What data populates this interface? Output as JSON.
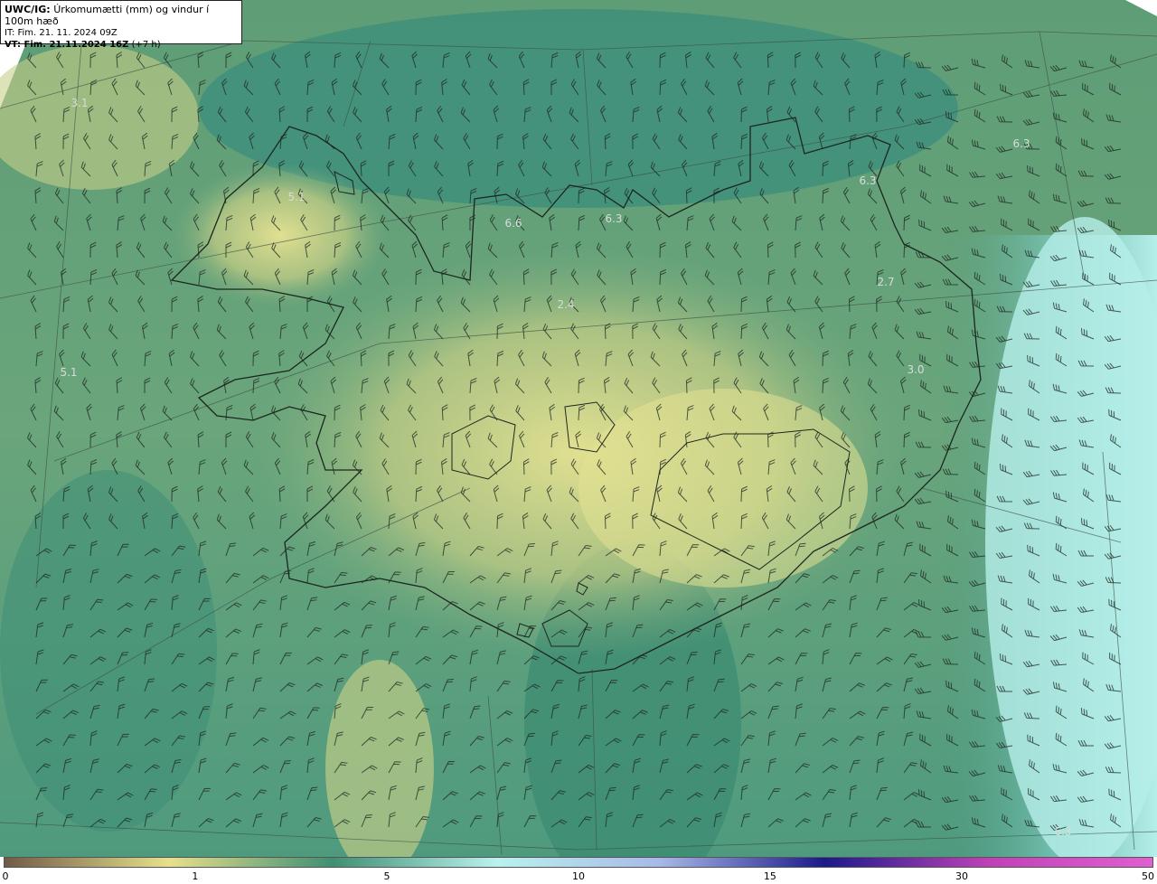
{
  "header": {
    "product": "UWC/IG:",
    "title": "Úrkomumætti (mm) og vindur í 100m hæð",
    "init_time": "IT: Fim. 21. 11. 2024 09Z",
    "valid_time_label": "VT: Fim. 21.11.2024 16Z",
    "lead": "(+7 h)"
  },
  "legend": {
    "ticks": [
      {
        "label": "0",
        "pos": 0.0
      },
      {
        "label": "1",
        "pos": 0.1666
      },
      {
        "label": "5",
        "pos": 0.3333
      },
      {
        "label": "10",
        "pos": 0.5
      },
      {
        "label": "15",
        "pos": 0.6666
      },
      {
        "label": "30",
        "pos": 0.8333
      },
      {
        "label": "50",
        "pos": 1.0
      }
    ],
    "colors": [
      "#6f5b45",
      "#e8e08a",
      "#3f8f72",
      "#b9f2ee",
      "#a8b8e8",
      "#1a1a8a",
      "#c040b8",
      "#e060d0"
    ]
  },
  "values": [
    {
      "label": "3.1"
    },
    {
      "label": "5.1"
    },
    {
      "label": "5.1"
    },
    {
      "label": "6.6"
    },
    {
      "label": "6.3"
    },
    {
      "label": "2.4"
    },
    {
      "label": "6.3"
    },
    {
      "label": "6.3"
    },
    {
      "label": "2.7"
    },
    {
      "label": "3.0"
    },
    {
      "label": "6.3"
    }
  ],
  "colors": {
    "land_yellow": "#e3e08f",
    "mid_green": "#5f9f79",
    "teal": "#3a8a78",
    "cyan": "#a4e6df"
  }
}
